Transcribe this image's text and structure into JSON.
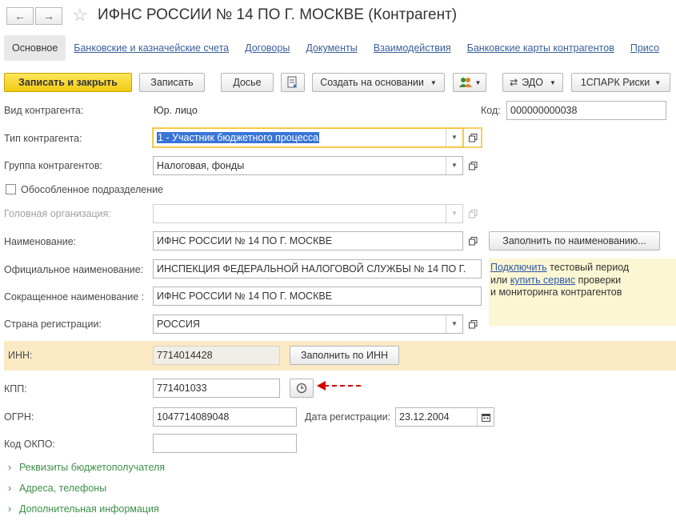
{
  "window": {
    "title": "ИФНС РОССИИ № 14 ПО Г. МОСКВЕ (Контрагент)"
  },
  "tabs": [
    {
      "label": "Основное"
    },
    {
      "label": "Банковские и казначейские счета"
    },
    {
      "label": "Договоры"
    },
    {
      "label": "Документы"
    },
    {
      "label": "Взаимодействия"
    },
    {
      "label": "Банковские карты контрагентов"
    },
    {
      "label": "Присо"
    }
  ],
  "toolbar": {
    "save_close": "Записать и закрыть",
    "save": "Записать",
    "dossier": "Досье",
    "create_based": "Создать на основании",
    "edo": "ЭДО",
    "spark": "1СПАРК Риски"
  },
  "form": {
    "kind_label": "Вид контрагента:",
    "kind_value": "Юр. лицо",
    "code_label": "Код:",
    "code_value": "000000000038",
    "type_label": "Тип контрагента:",
    "type_value": "1 - Участник бюджетного процесса",
    "group_label": "Группа контрагентов:",
    "group_value": "Налоговая, фонды",
    "separate_label": "Обособленное подразделение",
    "head_org_label": "Головная организация:",
    "head_org_value": "",
    "name_label": "Наименование:",
    "name_value": "ИФНС РОССИИ № 14 ПО Г. МОСКВЕ",
    "fill_by_name": "Заполнить по наименованию...",
    "official_label": "Официальное наименование:",
    "official_value": "ИНСПЕКЦИЯ ФЕДЕРАЛЬНОЙ НАЛОГОВОЙ СЛУЖБЫ № 14 ПО Г.",
    "short_label": "Сокращенное наименование :",
    "short_value": "ИФНС РОССИИ № 14 ПО Г. МОСКВЕ",
    "country_label": "Страна регистрации:",
    "country_value": "РОССИЯ",
    "inn_label": "ИНН:",
    "inn_value": "7714014428",
    "fill_by_inn": "Заполнить по ИНН",
    "kpp_label": "КПП:",
    "kpp_value": "771401033",
    "ogrn_label": "ОГРН:",
    "ogrn_value": "1047714089048",
    "reg_date_label": "Дата регистрации:",
    "reg_date_value": "23.12.2004",
    "okpo_label": "Код ОКПО:",
    "okpo_value": ""
  },
  "promo": {
    "connect_link": "Подключить",
    "text1": " тестовый период",
    "or": "или ",
    "buy_link": "купить сервис",
    "text2": " проверки",
    "text3": "и мониторинга контрагентов"
  },
  "sections": [
    {
      "label": "Реквизиты бюджетополучателя"
    },
    {
      "label": "Адреса, телефоны"
    },
    {
      "label": "Дополнительная информация"
    }
  ],
  "colors": {
    "accent_yellow": "#f2cb10",
    "link_blue": "#2d57a8",
    "section_green": "#3f8f4b",
    "inn_highlight": "#fbe9c4",
    "annotation_red": "#d40000"
  }
}
